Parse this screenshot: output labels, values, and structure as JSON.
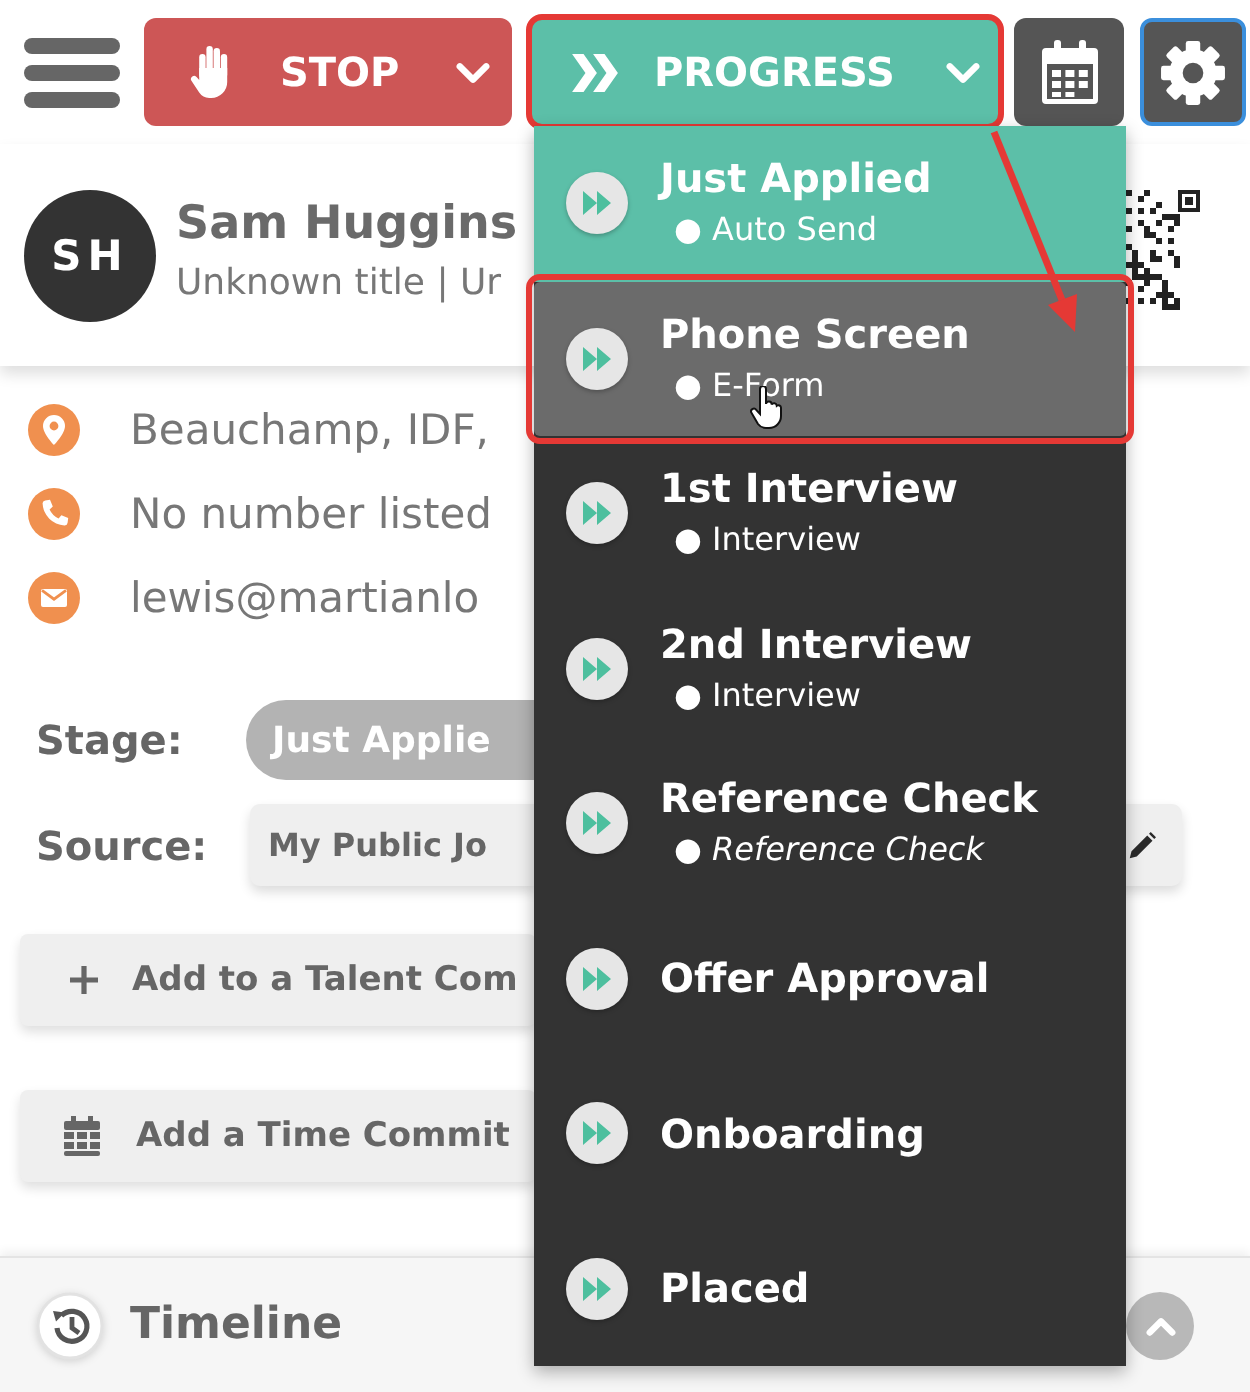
{
  "toolbar": {
    "stop": {
      "label": "STOP"
    },
    "progress": {
      "label": "PROGRESS",
      "highlighted": true,
      "expanded": true
    }
  },
  "candidate": {
    "initials": "SH",
    "name": "Sam Huggins",
    "subtitle": "Unknown title | Ur"
  },
  "contacts": [
    {
      "kind": "location",
      "text": "Beauchamp, IDF,"
    },
    {
      "kind": "phone",
      "text": "No number listed"
    },
    {
      "kind": "email",
      "text": "lewis@martianlo"
    }
  ],
  "stage": {
    "label": "Stage:",
    "value": "Just Applie"
  },
  "source": {
    "label": "Source:",
    "value": "My Public Jo"
  },
  "actions": [
    {
      "kind": "add",
      "label": "Add to a Talent Com"
    },
    {
      "kind": "schedule",
      "label": "Add a Time Commit"
    }
  ],
  "timeline": {
    "title": "Timeline"
  },
  "stage_menu": {
    "items": [
      {
        "title": "Just Applied",
        "subtitle": "● Auto Send",
        "subtitle_italic": false,
        "selected": true,
        "hovered": false,
        "highlighted": false
      },
      {
        "title": "Phone Screen",
        "subtitle": "● E-Form",
        "subtitle_italic": false,
        "selected": false,
        "hovered": true,
        "highlighted": true
      },
      {
        "title": "1st Interview",
        "subtitle": "● Interview",
        "subtitle_italic": false,
        "selected": false,
        "hovered": false,
        "highlighted": false
      },
      {
        "title": "2nd Interview",
        "subtitle": "● Interview",
        "subtitle_italic": false,
        "selected": false,
        "hovered": false,
        "highlighted": false
      },
      {
        "title": "Reference Check",
        "subtitle": "● Reference Check",
        "subtitle_italic": true,
        "selected": false,
        "hovered": false,
        "highlighted": false
      },
      {
        "title": "Offer Approval",
        "selected": false,
        "hovered": false,
        "highlighted": false
      },
      {
        "title": "Onboarding",
        "selected": false,
        "hovered": false,
        "highlighted": false
      },
      {
        "title": "Placed",
        "selected": false,
        "hovered": false,
        "highlighted": false
      }
    ]
  }
}
